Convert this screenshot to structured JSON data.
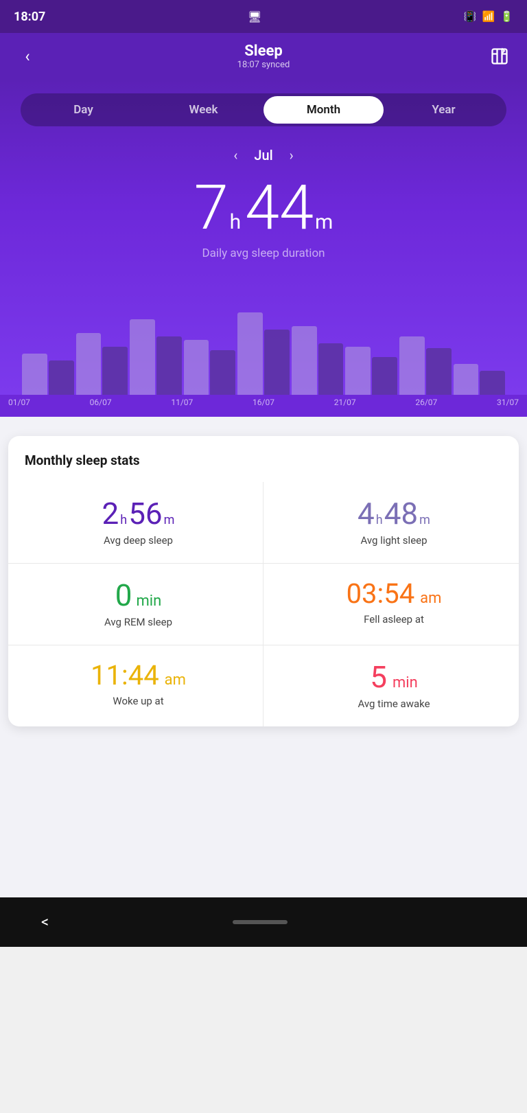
{
  "statusBar": {
    "time": "18:07",
    "icons": [
      "📱",
      "🔋"
    ]
  },
  "header": {
    "title": "Sleep",
    "synced": "18:07 synced",
    "backLabel": "<",
    "exportLabel": "⬡"
  },
  "tabs": {
    "items": [
      "Day",
      "Week",
      "Month",
      "Year"
    ],
    "activeIndex": 2
  },
  "monthNav": {
    "prev": "‹",
    "label": "Jul",
    "next": "›"
  },
  "sleepDuration": {
    "hours": "7",
    "hoursUnit": "h",
    "minutes": "44",
    "minutesUnit": "m",
    "label": "Daily avg sleep duration"
  },
  "chartLabels": [
    "01/07",
    "06/07",
    "11/07",
    "16/07",
    "21/07",
    "26/07",
    "31/07"
  ],
  "bars": [
    {
      "light": 60,
      "dark": 50
    },
    {
      "light": 90,
      "dark": 70
    },
    {
      "light": 110,
      "dark": 85
    },
    {
      "light": 80,
      "dark": 65
    },
    {
      "light": 120,
      "dark": 95
    },
    {
      "light": 100,
      "dark": 75
    },
    {
      "light": 70,
      "dark": 55
    },
    {
      "light": 85,
      "dark": 68
    },
    {
      "light": 45,
      "dark": 35
    }
  ],
  "statsCard": {
    "title": "Monthly sleep stats",
    "stats": [
      {
        "key": "avg-deep-sleep",
        "valueBig": "2",
        "valueUnit": "h",
        "valueSub": "56",
        "valueSubUnit": "m",
        "label": "Avg deep sleep",
        "colorClass": "color-deep"
      },
      {
        "key": "avg-light-sleep",
        "valueBig": "4",
        "valueUnit": "h",
        "valueSub": "48",
        "valueSubUnit": "m",
        "label": "Avg light sleep",
        "colorClass": "color-light-sleep"
      },
      {
        "key": "avg-rem-sleep",
        "valueBig": "0",
        "valueUnit": "",
        "valueSub": "min",
        "valueSubUnit": "",
        "label": "Avg REM sleep",
        "colorClass": "color-rem"
      },
      {
        "key": "fell-asleep-at",
        "valueBig": "03:54",
        "valueUnit": "",
        "valueSub": "am",
        "valueSubUnit": "",
        "label": "Fell asleep at",
        "colorClass": "color-fell-asleep"
      },
      {
        "key": "woke-up-at",
        "valueBig": "11:44",
        "valueUnit": "",
        "valueSub": "am",
        "valueSubUnit": "",
        "label": "Woke up at",
        "colorClass": "color-woke-up"
      },
      {
        "key": "avg-time-awake",
        "valueBig": "5",
        "valueUnit": "",
        "valueSub": "min",
        "valueSubUnit": "",
        "label": "Avg time awake",
        "colorClass": "color-time-awake"
      }
    ]
  },
  "bottomBar": {
    "backLabel": "<"
  }
}
